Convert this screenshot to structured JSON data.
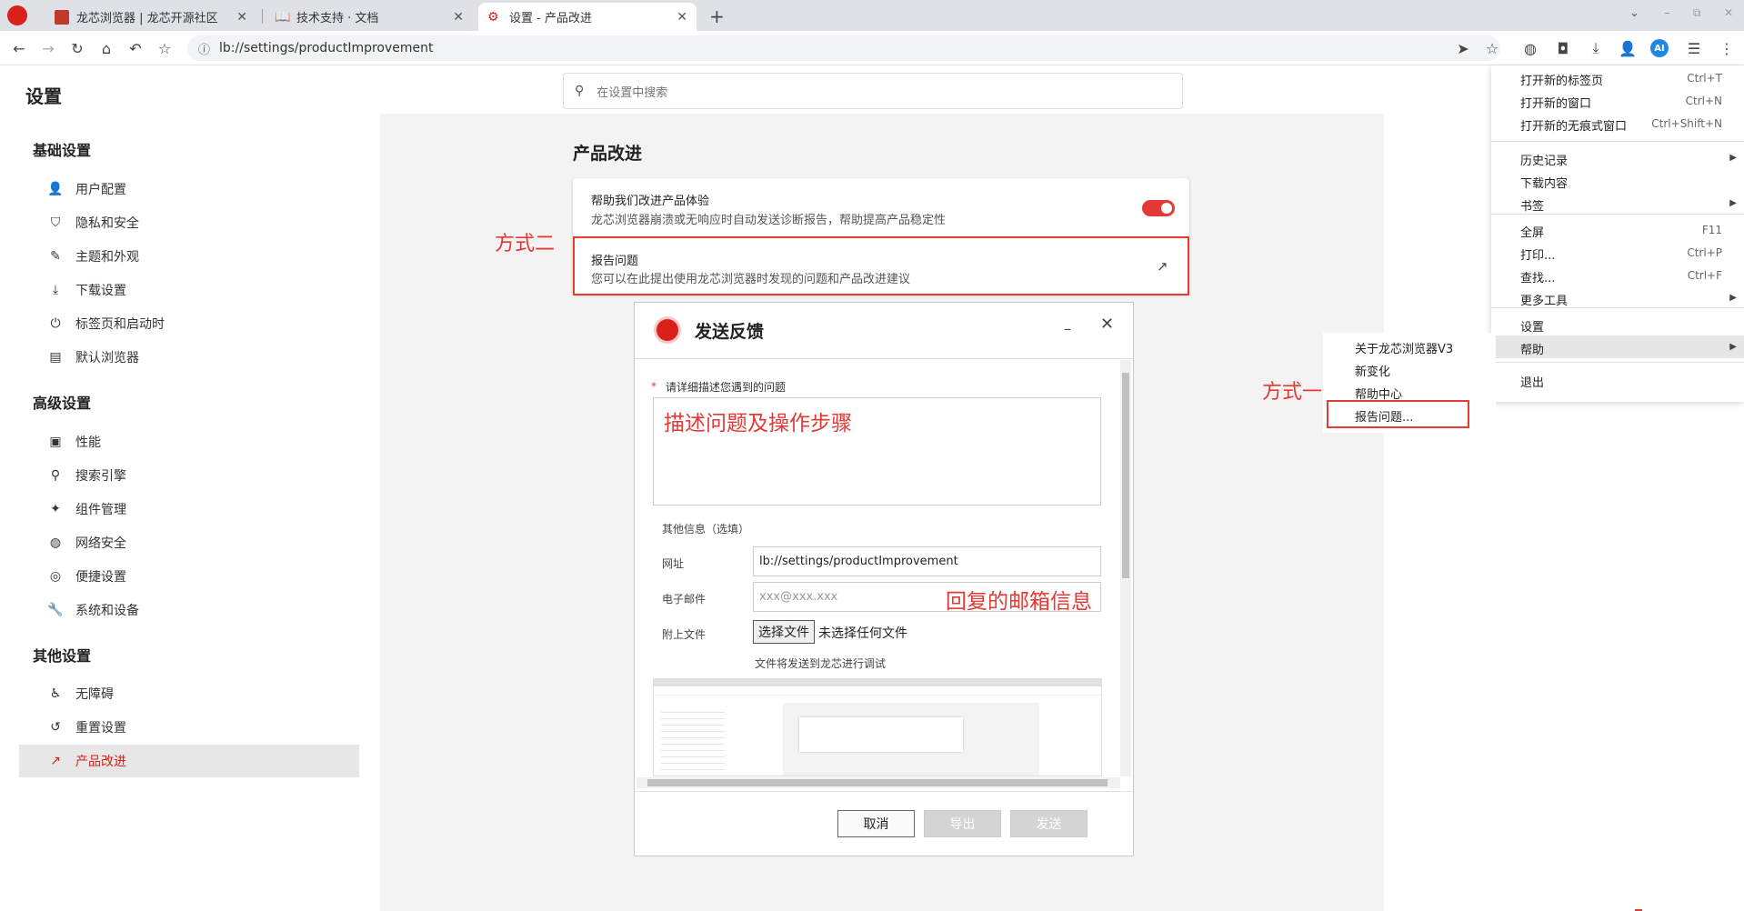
{
  "tabs": [
    {
      "label": "龙芯浏览器 | 龙芯开源社区"
    },
    {
      "label": "技术支持 · 文档"
    },
    {
      "label": "设置 - 产品改进"
    }
  ],
  "toolbar": {
    "url": "lb://settings/productImprovement",
    "ai_label": "AI"
  },
  "settings": {
    "title": "设置",
    "search_placeholder": "在设置中搜索",
    "sections": [
      {
        "title": "基础设置",
        "items": [
          "用户配置",
          "隐私和安全",
          "主题和外观",
          "下载设置",
          "标签页和启动时",
          "默认浏览器"
        ]
      },
      {
        "title": "高级设置",
        "items": [
          "性能",
          "搜索引擎",
          "组件管理",
          "网络安全",
          "便捷设置",
          "系统和设备"
        ]
      },
      {
        "title": "其他设置",
        "items": [
          "无障碍",
          "重置设置",
          "产品改进"
        ]
      }
    ],
    "page_heading": "产品改进",
    "improve_title": "帮助我们改进产品体验",
    "improve_desc": "龙芯浏览器崩溃或无响应时自动发送诊断报告，帮助提高产品稳定性",
    "report_title": "报告问题",
    "report_desc": "您可以在此提出使用龙芯浏览器时发现的问题和产品改进建议"
  },
  "annotations": {
    "method_two": "方式二",
    "method_one": "方式一",
    "describe": "描述问题及操作步骤",
    "email_hint": "回复的邮箱信息"
  },
  "dialog": {
    "title": "发送反馈",
    "required_mark": "*",
    "describe_label": "请详细描述您遇到的问题",
    "other_info": "其他信息（选填）",
    "url_label": "网址",
    "url_value": "lb://settings/productImprovement",
    "email_label": "电子邮件",
    "email_placeholder": "xxx@xxx.xxx",
    "attach_label": "附上文件",
    "choose_file": "选择文件",
    "no_file": "未选择任何文件",
    "send_note": "文件将发送到龙芯进行调试",
    "cancel": "取消",
    "export": "导出",
    "send": "发送"
  },
  "menu": {
    "items": [
      {
        "label": "打开新的标签页",
        "shortcut": "Ctrl+T"
      },
      {
        "label": "打开新的窗口",
        "shortcut": "Ctrl+N"
      },
      {
        "label": "打开新的无痕式窗口",
        "shortcut": "Ctrl+Shift+N"
      },
      {
        "label": "历史记录",
        "shortcut": ""
      },
      {
        "label": "下载内容",
        "shortcut": ""
      },
      {
        "label": "书签",
        "shortcut": ""
      },
      {
        "label": "全屏",
        "shortcut": "F11"
      },
      {
        "label": "打印...",
        "shortcut": "Ctrl+P"
      },
      {
        "label": "查找...",
        "shortcut": "Ctrl+F"
      },
      {
        "label": "更多工具",
        "shortcut": ""
      },
      {
        "label": "设置",
        "shortcut": ""
      },
      {
        "label": "帮助",
        "shortcut": ""
      },
      {
        "label": "退出",
        "shortcut": ""
      }
    ],
    "help_submenu": [
      "关于龙芯浏览器V3",
      "新变化",
      "帮助中心",
      "报告问题..."
    ]
  },
  "colors": {
    "accent": "#d9201b",
    "annotation": "#e53935",
    "toggle": "#e53935"
  }
}
